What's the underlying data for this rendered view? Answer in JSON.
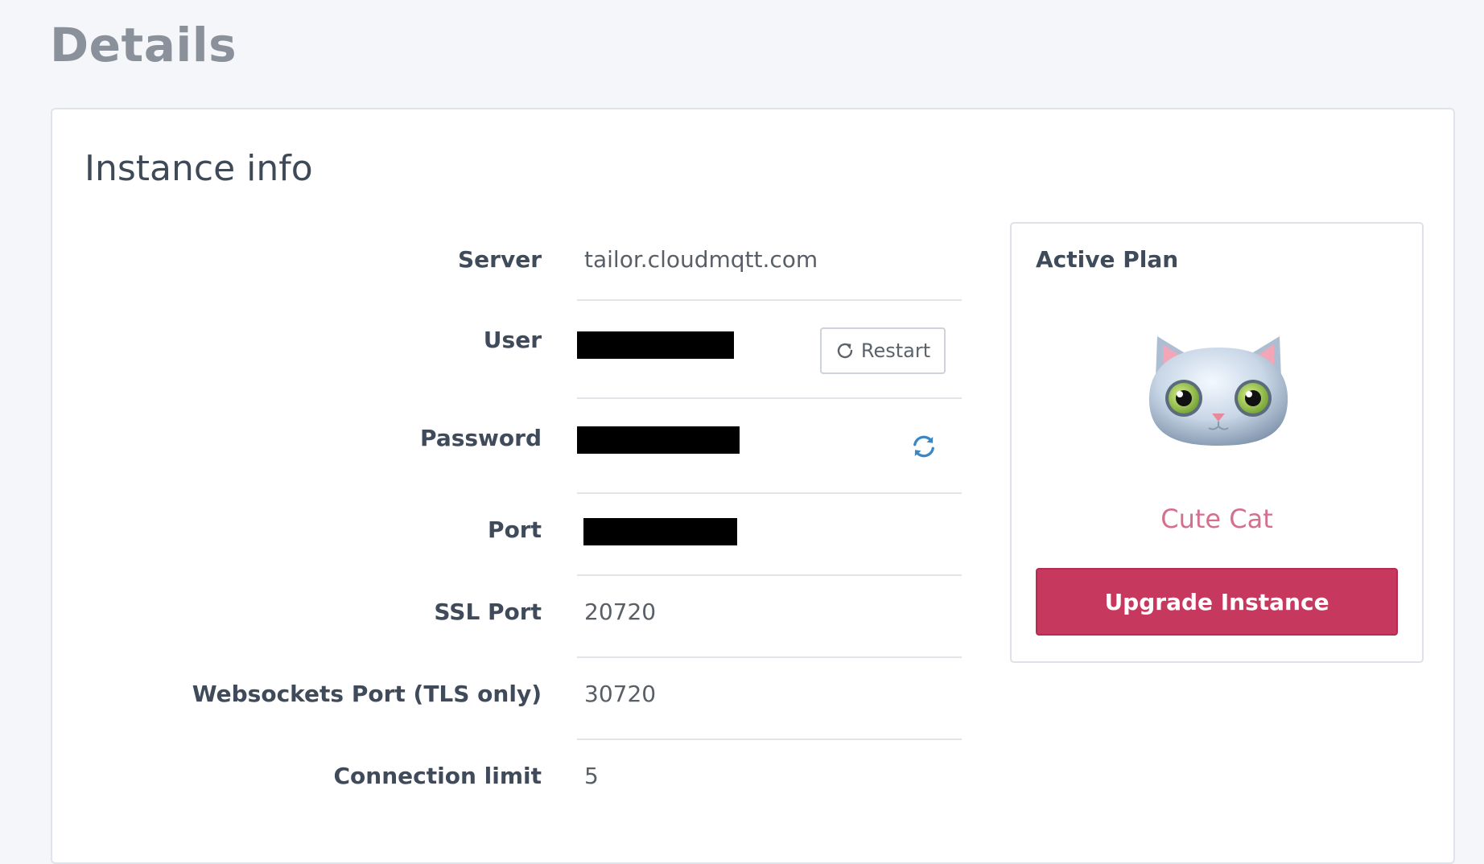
{
  "page": {
    "title": "Details"
  },
  "instance_info": {
    "title": "Instance info",
    "rows": [
      {
        "label": "Server",
        "value": "tailor.cloudmqtt.com"
      },
      {
        "label": "User",
        "value": ""
      },
      {
        "label": "Password",
        "value": ""
      },
      {
        "label": "Port",
        "value": ""
      },
      {
        "label": "SSL Port",
        "value": "20720"
      },
      {
        "label": "Websockets Port (TLS only)",
        "value": "30720"
      },
      {
        "label": "Connection limit",
        "value": "5"
      }
    ],
    "restart_label": "Restart"
  },
  "active_plan": {
    "heading": "Active Plan",
    "plan_name": "Cute Cat",
    "upgrade_label": "Upgrade Instance"
  },
  "icons": {
    "restart": "restart-icon",
    "refresh": "refresh-icon",
    "plan": "cat-mascot"
  },
  "colors": {
    "brand_accent": "#c7385f",
    "plan_name": "#d4708e",
    "refresh_icon": "#3b86c4",
    "redaction": "#000000"
  }
}
